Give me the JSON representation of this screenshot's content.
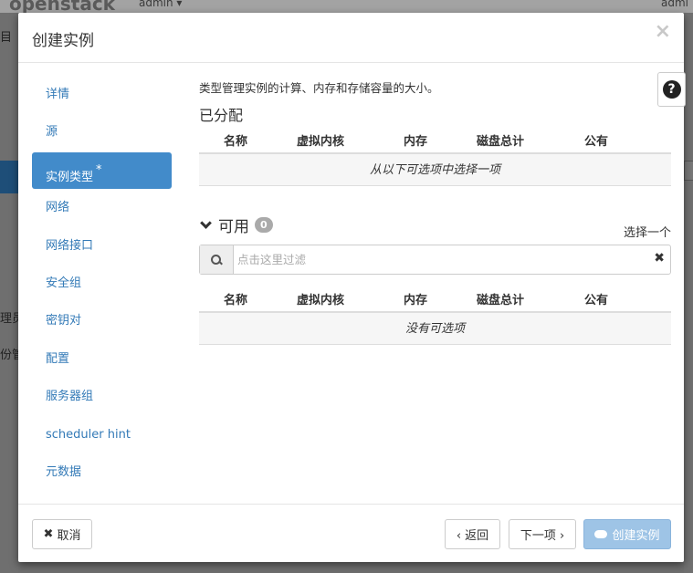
{
  "background": {
    "logo": "openstack",
    "user_left": "admin ▾",
    "user_right": "admi",
    "left_fragments": [
      "目",
      "理员",
      "份管"
    ]
  },
  "modal": {
    "title": "创建实例",
    "close_symbol": "×"
  },
  "nav": {
    "items": [
      {
        "label": "详情"
      },
      {
        "label": "源"
      },
      {
        "label": "实例类型",
        "required_mark": "*",
        "active": true
      },
      {
        "label": "网络"
      },
      {
        "label": "网络接口"
      },
      {
        "label": "安全组"
      },
      {
        "label": "密钥对"
      },
      {
        "label": "配置"
      },
      {
        "label": "服务器组"
      },
      {
        "label": "scheduler hint"
      },
      {
        "label": "元数据"
      }
    ]
  },
  "content": {
    "description": "类型管理实例的计算、内存和存储容量的大小。",
    "help_symbol": "?",
    "allocated": {
      "title": "已分配",
      "columns": [
        "名称",
        "虚拟内核",
        "内存",
        "磁盘总计",
        "公有"
      ],
      "empty_text": "从以下可选项中选择一项"
    },
    "available": {
      "title": "可用",
      "count": "0",
      "select_one": "选择一个",
      "search_placeholder": "点击这里过滤",
      "columns": [
        "名称",
        "虚拟内核",
        "内存",
        "磁盘总计",
        "公有"
      ],
      "empty_text": "没有可选项"
    }
  },
  "footer": {
    "cancel": "取消",
    "cancel_icon": "✖",
    "back": "‹ 返回",
    "next": "下一项 ›",
    "create": "创建实例"
  }
}
